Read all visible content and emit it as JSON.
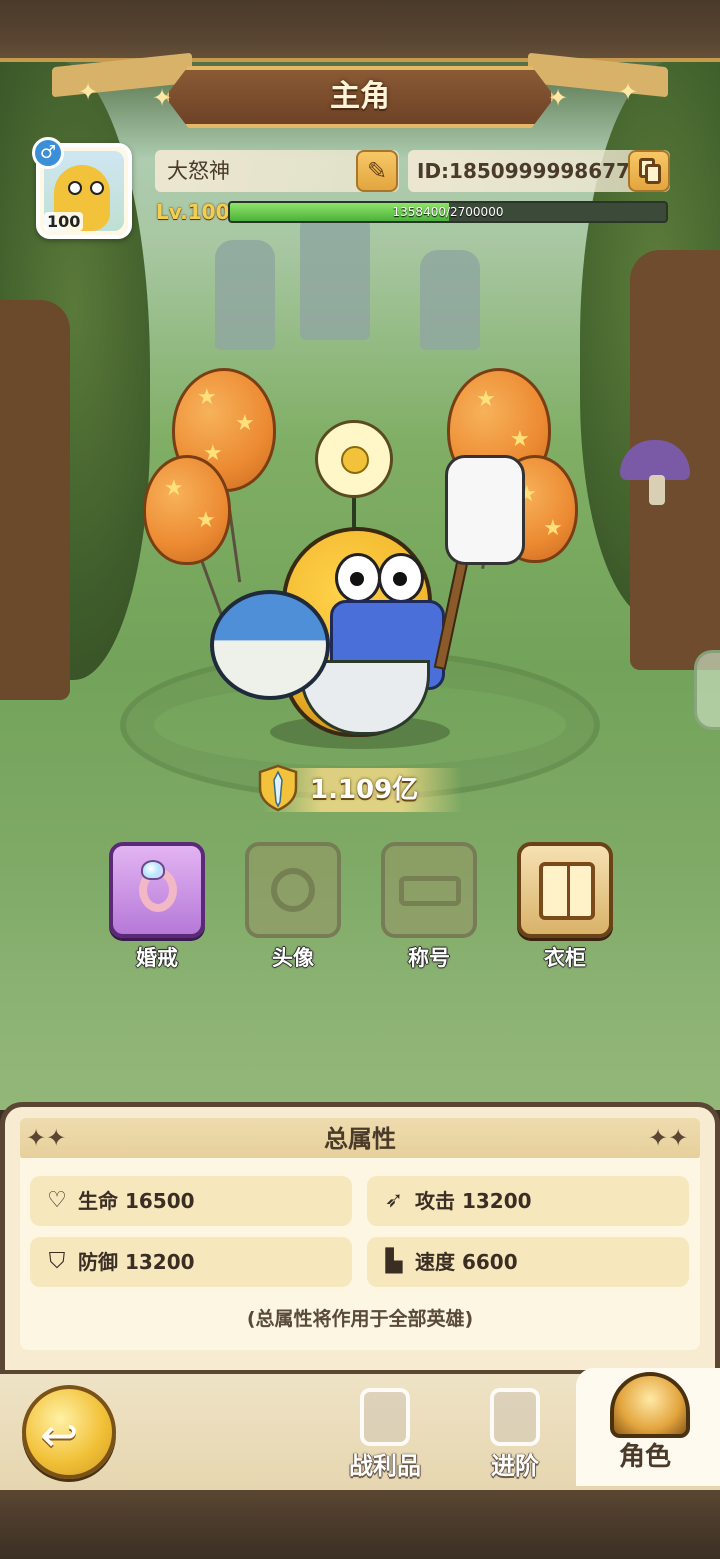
{
  "header": {
    "title": "主角"
  },
  "profile": {
    "gender_symbol": "♂",
    "avatar_level": "100",
    "name": "大怒神",
    "id_text": "ID:1850999998677",
    "level_text": "Lv.100",
    "exp_text": "1358400/2700000",
    "exp_fraction": 0.503
  },
  "power": {
    "value": "1.109亿"
  },
  "features": [
    {
      "label": "婚戒",
      "state": "unlocked",
      "icon": "ring-icon"
    },
    {
      "label": "头像",
      "state": "locked",
      "icon": "avatar-frame-icon"
    },
    {
      "label": "称号",
      "state": "locked",
      "icon": "title-crown-icon"
    },
    {
      "label": "衣柜",
      "state": "unlocked",
      "icon": "wardrobe-book-icon"
    }
  ],
  "attributes": {
    "title": "总属性",
    "hp": "生命 16500",
    "attack": "攻击 13200",
    "defense": "防御 13200",
    "speed": "速度 6600",
    "note": "(总属性将作用于全部英雄)"
  },
  "nav": {
    "loot_label": "战利品",
    "advance_label": "进阶",
    "character_label": "角色",
    "active_tab": "角色"
  },
  "colors": {
    "exp_green": "#4cb23a",
    "gold": "#f2c23a",
    "panel_bg": "#f7ecd2",
    "ring_purple": "#b679d8"
  }
}
